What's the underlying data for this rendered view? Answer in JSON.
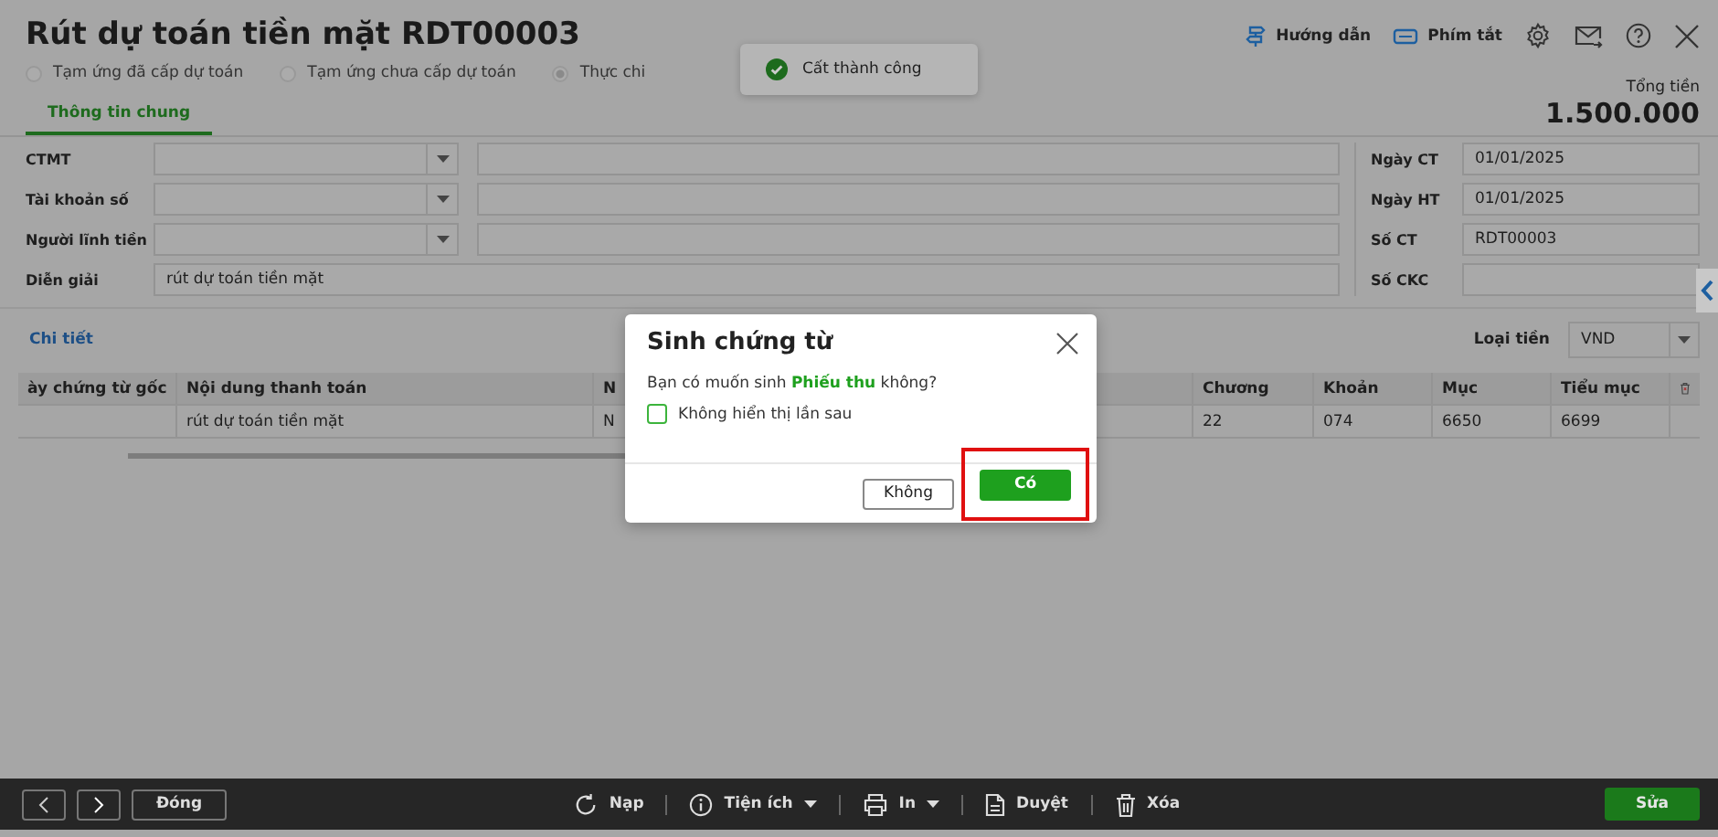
{
  "title": "Rút dự toán tiền mặt RDT00003",
  "header_actions": [
    {
      "kind": "guide",
      "label": "Hướng dẫn"
    },
    {
      "kind": "shortcut",
      "label": "Phím tắt"
    },
    {
      "kind": "settings"
    },
    {
      "kind": "mail"
    },
    {
      "kind": "help"
    },
    {
      "kind": "close"
    }
  ],
  "toast": {
    "text": "Cất thành công"
  },
  "payment_types": [
    {
      "label": "Tạm ứng đã cấp dự toán",
      "selected": false
    },
    {
      "label": "Tạm ứng chưa cấp dự toán",
      "selected": false
    },
    {
      "label": "Thực chi",
      "selected": true
    }
  ],
  "tabs": [
    {
      "label": "Thông tin chung",
      "selected": true
    }
  ],
  "total": {
    "label": "Tổng tiền",
    "value": "1.500.000"
  },
  "form_left": [
    {
      "label": "CTMT",
      "kind": "combo"
    },
    {
      "label": "Tài khoản số",
      "kind": "combo"
    },
    {
      "label": "Người lĩnh tiền",
      "kind": "combo"
    },
    {
      "label": "Diễn giải",
      "kind": "text",
      "value": "rút dự toán tiền mặt"
    }
  ],
  "form_right": [
    {
      "label": "Ngày CT",
      "value": "01/01/2025"
    },
    {
      "label": "Ngày HT",
      "value": "01/01/2025"
    },
    {
      "label": "Số CT",
      "value": "RDT00003"
    },
    {
      "label": "Số CKC"
    }
  ],
  "detail": {
    "title": "Chi tiết",
    "currency_label": "Loại tiền",
    "currency": "VND",
    "columns": [
      "ày chứng từ gốc",
      "Nội dung thanh toán",
      "N",
      null,
      "Chương",
      "Khoản",
      "Mục",
      "Tiểu mục"
    ],
    "rows": [
      {
        "cells": [
          null,
          "rút dự toán tiền mặt",
          "N",
          null,
          "22",
          "074",
          "6650",
          "6699"
        ]
      }
    ]
  },
  "dialog": {
    "title": "Sinh chứng từ",
    "message": "Bạn có muốn sinh **Phiếu thu** không?",
    "dont_show_again": {
      "label": "Không hiển thị lần sau",
      "checked": false
    },
    "buttons": [
      {
        "label": "Không",
        "kind": "secondary",
        "highlighted": false
      },
      {
        "label": "Có",
        "kind": "primary",
        "highlighted": true
      }
    ]
  },
  "toolbar": {
    "left": [
      {
        "kind": "prev"
      },
      {
        "kind": "next"
      },
      {
        "kind": "text",
        "label": "Đóng"
      }
    ],
    "center": [
      {
        "kind": "reload",
        "label": "Nạp",
        "dropdown": false
      },
      {
        "kind": "utilities",
        "label": "Tiện ích",
        "dropdown": true
      },
      {
        "kind": "print",
        "label": "In",
        "dropdown": true
      },
      {
        "kind": "approve",
        "label": "Duyệt",
        "dropdown": false
      },
      {
        "kind": "delete",
        "label": "Xóa",
        "dropdown": false
      }
    ],
    "right": {
      "label": "Sửa"
    }
  }
}
